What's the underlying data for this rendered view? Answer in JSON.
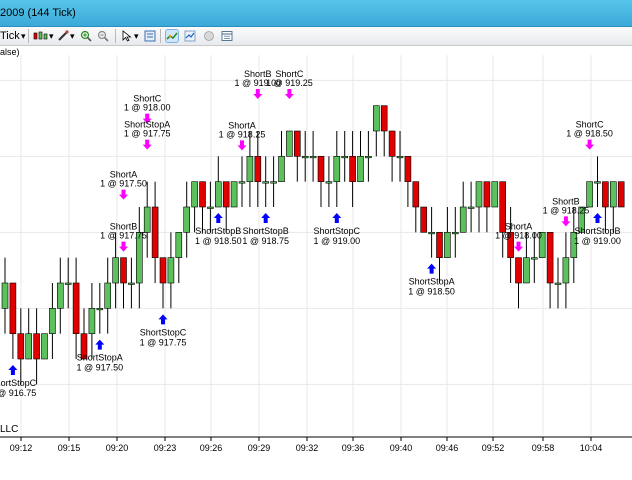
{
  "window": {
    "title": "2009 (144 Tick)"
  },
  "toolbar": {
    "interval_label": "Tick",
    "buttons": [
      {
        "name": "candlestick-style-icon",
        "active": false
      },
      {
        "name": "drawing-tool-icon",
        "active": false
      },
      {
        "name": "zoom-in-icon",
        "active": false
      },
      {
        "name": "zoom-out-icon",
        "active": false
      },
      {
        "name": "cursor-arrow-icon",
        "active": false
      },
      {
        "name": "data-box-icon",
        "active": false
      },
      {
        "name": "strategy-icon",
        "active": true
      },
      {
        "name": "indicator-icon",
        "active": false
      },
      {
        "name": "circle-icon",
        "active": false
      },
      {
        "name": "properties-icon",
        "active": false
      }
    ]
  },
  "chart_header": "alse)",
  "footer_text": "LLC",
  "colors": {
    "up": "#5cc05c",
    "down": "#e00000",
    "short_arrow": "#ff00ff",
    "cover_arrow": "#0000ff",
    "grid": "#e8e8e8"
  },
  "chart_data": {
    "type": "candlestick",
    "x_ticks": [
      "09:12",
      "09:15",
      "09:20",
      "09:23",
      "09:26",
      "09:29",
      "09:32",
      "09:36",
      "09:40",
      "09:46",
      "09:52",
      "09:58",
      "10:04"
    ],
    "candles": [
      {
        "o": 917.5,
        "c": 917.75,
        "h": 918.0,
        "l": 917.25
      },
      {
        "o": 917.75,
        "c": 917.25,
        "h": 917.75,
        "l": 917.0
      },
      {
        "o": 917.25,
        "c": 917.0,
        "h": 917.5,
        "l": 916.75
      },
      {
        "o": 917.0,
        "c": 917.25,
        "h": 917.5,
        "l": 917.0
      },
      {
        "o": 917.25,
        "c": 917.0,
        "h": 917.5,
        "l": 916.75
      },
      {
        "o": 917.0,
        "c": 917.25,
        "h": 917.25,
        "l": 917.0
      },
      {
        "o": 917.25,
        "c": 917.5,
        "h": 917.75,
        "l": 917.0
      },
      {
        "o": 917.5,
        "c": 917.75,
        "h": 918.0,
        "l": 917.25
      },
      {
        "o": 917.75,
        "c": 917.75,
        "h": 918.0,
        "l": 917.5
      },
      {
        "o": 917.75,
        "c": 917.25,
        "h": 918.0,
        "l": 917.0
      },
      {
        "o": 917.25,
        "c": 917.0,
        "h": 917.5,
        "l": 917.0
      },
      {
        "o": 917.25,
        "c": 917.5,
        "h": 917.75,
        "l": 917.0
      },
      {
        "o": 917.5,
        "c": 917.5,
        "h": 917.75,
        "l": 917.25
      },
      {
        "o": 917.5,
        "c": 917.75,
        "h": 918.0,
        "l": 917.25
      },
      {
        "o": 917.75,
        "c": 918.0,
        "h": 918.25,
        "l": 917.5
      },
      {
        "o": 918.0,
        "c": 917.75,
        "h": 918.0,
        "l": 917.5
      },
      {
        "o": 917.75,
        "c": 917.75,
        "h": 918.0,
        "l": 917.5
      },
      {
        "o": 917.75,
        "c": 918.25,
        "h": 918.5,
        "l": 917.5
      },
      {
        "o": 918.25,
        "c": 918.5,
        "h": 918.75,
        "l": 918.0
      },
      {
        "o": 918.5,
        "c": 918.0,
        "h": 918.75,
        "l": 917.75
      },
      {
        "o": 918.0,
        "c": 917.75,
        "h": 918.0,
        "l": 917.5
      },
      {
        "o": 917.75,
        "c": 918.0,
        "h": 918.25,
        "l": 917.5
      },
      {
        "o": 918.0,
        "c": 918.25,
        "h": 918.25,
        "l": 917.75
      },
      {
        "o": 918.25,
        "c": 918.5,
        "h": 918.75,
        "l": 918.0
      },
      {
        "o": 918.5,
        "c": 918.75,
        "h": 918.75,
        "l": 918.25
      },
      {
        "o": 918.75,
        "c": 918.5,
        "h": 918.75,
        "l": 918.25
      },
      {
        "o": 918.5,
        "c": 918.5,
        "h": 918.75,
        "l": 918.25
      },
      {
        "o": 918.5,
        "c": 918.75,
        "h": 919.0,
        "l": 918.5
      },
      {
        "o": 918.75,
        "c": 918.5,
        "h": 918.75,
        "l": 918.25
      },
      {
        "o": 918.5,
        "c": 918.75,
        "h": 918.75,
        "l": 918.5
      },
      {
        "o": 918.75,
        "c": 918.75,
        "h": 919.0,
        "l": 918.5
      },
      {
        "o": 918.75,
        "c": 919.0,
        "h": 919.25,
        "l": 918.5
      },
      {
        "o": 919.0,
        "c": 918.75,
        "h": 919.25,
        "l": 918.5
      },
      {
        "o": 918.75,
        "c": 918.75,
        "h": 919.0,
        "l": 918.5
      },
      {
        "o": 918.75,
        "c": 918.75,
        "h": 919.0,
        "l": 918.5
      },
      {
        "o": 918.75,
        "c": 919.0,
        "h": 919.25,
        "l": 918.75
      },
      {
        "o": 919.0,
        "c": 919.25,
        "h": 919.25,
        "l": 919.0
      },
      {
        "o": 919.25,
        "c": 919.0,
        "h": 919.25,
        "l": 918.75
      },
      {
        "o": 919.0,
        "c": 919.0,
        "h": 919.25,
        "l": 918.75
      },
      {
        "o": 919.0,
        "c": 919.0,
        "h": 919.25,
        "l": 918.75
      },
      {
        "o": 919.0,
        "c": 918.75,
        "h": 919.0,
        "l": 918.5
      },
      {
        "o": 918.75,
        "c": 918.75,
        "h": 919.0,
        "l": 918.5
      },
      {
        "o": 918.75,
        "c": 919.0,
        "h": 919.25,
        "l": 918.5
      },
      {
        "o": 919.0,
        "c": 919.0,
        "h": 919.25,
        "l": 918.75
      },
      {
        "o": 919.0,
        "c": 918.75,
        "h": 919.25,
        "l": 918.5
      },
      {
        "o": 918.75,
        "c": 919.0,
        "h": 919.25,
        "l": 918.75
      },
      {
        "o": 919.0,
        "c": 919.0,
        "h": 919.25,
        "l": 918.75
      },
      {
        "o": 919.25,
        "c": 919.5,
        "h": 919.5,
        "l": 919.0
      },
      {
        "o": 919.5,
        "c": 919.25,
        "h": 919.5,
        "l": 919.0
      },
      {
        "o": 919.25,
        "c": 919.0,
        "h": 919.25,
        "l": 918.75
      },
      {
        "o": 919.0,
        "c": 919.0,
        "h": 919.25,
        "l": 918.75
      },
      {
        "o": 919.0,
        "c": 918.75,
        "h": 919.0,
        "l": 918.5
      },
      {
        "o": 918.75,
        "c": 918.5,
        "h": 918.75,
        "l": 918.25
      },
      {
        "o": 918.5,
        "c": 918.25,
        "h": 918.5,
        "l": 918.25
      },
      {
        "o": 918.25,
        "c": 918.25,
        "h": 918.5,
        "l": 918.0
      },
      {
        "o": 918.25,
        "c": 918.0,
        "h": 918.25,
        "l": 917.75
      },
      {
        "o": 918.0,
        "c": 918.25,
        "h": 918.5,
        "l": 918.0
      },
      {
        "o": 918.25,
        "c": 918.25,
        "h": 918.5,
        "l": 918.0
      },
      {
        "o": 918.25,
        "c": 918.5,
        "h": 918.75,
        "l": 918.25
      },
      {
        "o": 918.5,
        "c": 918.5,
        "h": 918.75,
        "l": 918.25
      },
      {
        "o": 918.5,
        "c": 918.75,
        "h": 918.75,
        "l": 918.25
      },
      {
        "o": 918.75,
        "c": 918.5,
        "h": 918.75,
        "l": 918.25
      },
      {
        "o": 918.5,
        "c": 918.75,
        "h": 918.75,
        "l": 918.5
      },
      {
        "o": 918.75,
        "c": 918.25,
        "h": 918.75,
        "l": 918.0
      },
      {
        "o": 918.25,
        "c": 918.0,
        "h": 918.5,
        "l": 917.75
      },
      {
        "o": 918.0,
        "c": 917.75,
        "h": 918.0,
        "l": 917.5
      },
      {
        "o": 917.75,
        "c": 918.0,
        "h": 918.25,
        "l": 917.75
      },
      {
        "o": 918.0,
        "c": 918.0,
        "h": 918.25,
        "l": 917.75
      },
      {
        "o": 918.0,
        "c": 918.25,
        "h": 918.25,
        "l": 918.0
      },
      {
        "o": 918.25,
        "c": 917.75,
        "h": 918.25,
        "l": 917.5
      },
      {
        "o": 917.75,
        "c": 917.75,
        "h": 918.0,
        "l": 917.5
      },
      {
        "o": 917.75,
        "c": 918.0,
        "h": 918.25,
        "l": 917.5
      },
      {
        "o": 918.0,
        "c": 918.25,
        "h": 918.5,
        "l": 917.75
      },
      {
        "o": 918.25,
        "c": 918.5,
        "h": 918.5,
        "l": 918.25
      },
      {
        "o": 918.5,
        "c": 918.75,
        "h": 918.75,
        "l": 918.5
      },
      {
        "o": 918.75,
        "c": 918.75,
        "h": 919.0,
        "l": 918.5
      },
      {
        "o": 918.75,
        "c": 918.5,
        "h": 918.75,
        "l": 918.25
      },
      {
        "o": 918.5,
        "c": 918.75,
        "h": 918.75,
        "l": 918.25
      },
      {
        "o": 918.75,
        "c": 918.5,
        "h": 918.75,
        "l": 918.5
      }
    ],
    "trades": [
      {
        "bar": 1,
        "dir": "cover",
        "label": "ShortStopC",
        "detail": "1 @ 916.75",
        "offset": 0
      },
      {
        "bar": 12,
        "dir": "cover",
        "label": "ShortStopA",
        "detail": "1 @ 917.50",
        "offset": 0
      },
      {
        "bar": 15,
        "dir": "short",
        "label": "ShortA",
        "detail": "1 @ 917.50",
        "offset": 2
      },
      {
        "bar": 15,
        "dir": "short",
        "label": "ShortB",
        "detail": "1 @ 917.75",
        "offset": 0
      },
      {
        "bar": 18,
        "dir": "short",
        "label": "ShortC",
        "detail": "1 @ 918.00",
        "offset": 2
      },
      {
        "bar": 18,
        "dir": "short",
        "label": "ShortStopA",
        "detail": "1 @ 917.75",
        "offset": 1
      },
      {
        "bar": 20,
        "dir": "cover",
        "label": "ShortStopC",
        "detail": "1 @ 917.75",
        "offset": 0
      },
      {
        "bar": 27,
        "dir": "cover",
        "label": "ShortStopB",
        "detail": "1 @ 918.50",
        "offset": 0
      },
      {
        "bar": 30,
        "dir": "short",
        "label": "ShortA",
        "detail": "1 @ 918.25",
        "offset": 0
      },
      {
        "bar": 32,
        "dir": "short",
        "label": "ShortB",
        "detail": "1 @ 919.00",
        "offset": 1
      },
      {
        "bar": 36,
        "dir": "short",
        "label": "ShortC",
        "detail": "1 @ 919.25",
        "offset": 1
      },
      {
        "bar": 33,
        "dir": "cover",
        "label": "ShortStopB",
        "detail": "1 @ 918.75",
        "offset": 0
      },
      {
        "bar": 42,
        "dir": "cover",
        "label": "ShortStopC",
        "detail": "1 @ 919.00",
        "offset": 0
      },
      {
        "bar": 54,
        "dir": "cover",
        "label": "ShortStopA",
        "detail": "1 @ 918.50",
        "offset": 0
      },
      {
        "bar": 65,
        "dir": "short",
        "label": "ShortA",
        "detail": "1 @ 918.00",
        "offset": 0
      },
      {
        "bar": 71,
        "dir": "short",
        "label": "ShortB",
        "detail": "1 @ 918.25",
        "offset": 0
      },
      {
        "bar": 74,
        "dir": "short",
        "label": "ShortC",
        "detail": "1 @ 918.50",
        "offset": 1
      },
      {
        "bar": 75,
        "dir": "cover",
        "label": "ShortStopB",
        "detail": "1 @ 919.00",
        "offset": 0
      }
    ]
  }
}
